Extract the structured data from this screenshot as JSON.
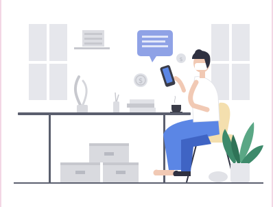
{
  "illustration": {
    "subject": "person-working-at-desk-with-phone",
    "icons": [
      "speech-bubble-icon",
      "dollar-coin-icon",
      "smartphone-icon",
      "plant-icon"
    ],
    "colors": {
      "window": "#e6e7ec",
      "window_frame": "#ffffff",
      "desk": "#5b5f6e",
      "boxes": "#d9dadf",
      "boxes_dark": "#c7c8ce",
      "pants": "#5b86e5",
      "shirt": "#ffffff",
      "hair": "#2f3141",
      "skin": "#f1c9b4",
      "chair": "#f4dfae",
      "plant": "#3d8a6b",
      "bubble": "#8fa2e6",
      "coin": "#dfe1e7",
      "floor": "#5b5f6e",
      "border": "#f3d6e4"
    }
  }
}
